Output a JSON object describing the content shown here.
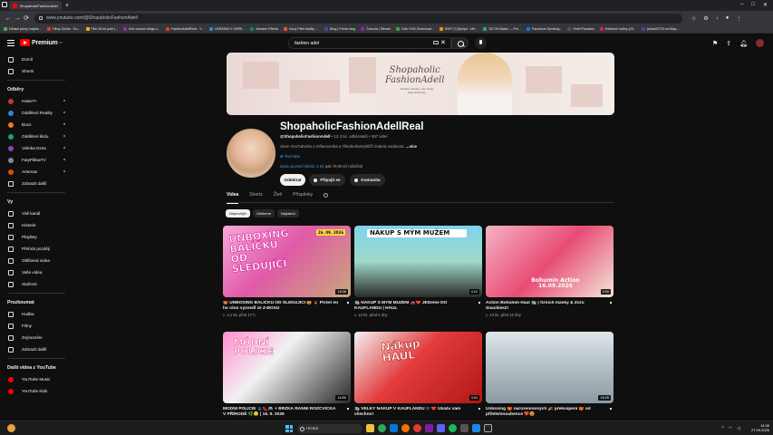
{
  "browser": {
    "tab_title": "ShopaholicFashionAdell...",
    "url": "www.youtube.com/@ShopaholicFashionAdell",
    "bookmarks": [
      "Dětské pleny hrajete...",
      "Filmy Online - Du...",
      "Film 28 let poté (...",
      "free custom bingo c...",
      "FashionAdellReal - Y...",
      "UKRAINA V ONRE...",
      "Monsen Effects",
      "Nový Pillet Addity -...",
      "Blog | Fomin-blog",
      "Čarnola | Stream",
      "Kick VOD Download...",
      "S907 (7)(5)mp4 - Mé...",
      "SD Gif Maker — Fre...",
      "Facebook Symboly...",
      "Hotel Paradise",
      "Edněmní rodiny (20...",
      "janka00733 na Mojo..."
    ]
  },
  "header": {
    "logo_text": "Premium",
    "logo_badge": "CZ",
    "search_value": "fashion adel"
  },
  "sidebar": {
    "main": [
      {
        "label": "Domů",
        "icon": "home-icon"
      },
      {
        "label": "Shorts",
        "icon": "shorts-icon"
      }
    ],
    "subs_heading": "Odběry",
    "subs": [
      {
        "label": "HaiseT+",
        "color": "#c0392b"
      },
      {
        "label": "Oddělení Reality",
        "color": "#2e86de"
      },
      {
        "label": "Buco",
        "color": "#e67e22"
      },
      {
        "label": "Oddělení klidu",
        "color": "#16a085"
      },
      {
        "label": "Volinka Extra",
        "color": "#8e44ad"
      },
      {
        "label": "FatyPillowTV",
        "color": "#7f8c8d"
      },
      {
        "label": "Artemas",
        "color": "#d35400"
      },
      {
        "label": "Zobrazit další",
        "color": ""
      }
    ],
    "you_heading": "Vy",
    "you": [
      {
        "label": "Váš kanál",
        "icon": "channel-icon"
      },
      {
        "label": "Historie",
        "icon": "history-icon"
      },
      {
        "label": "Playlisty",
        "icon": "playlist-icon"
      },
      {
        "label": "Přehrát později",
        "icon": "watch-later-icon"
      },
      {
        "label": "Oblíbená videa",
        "icon": "like-icon"
      },
      {
        "label": "Vaše videa",
        "icon": "your-videos-icon"
      },
      {
        "label": "Stažené",
        "icon": "download-icon"
      }
    ],
    "explore_heading": "Prozkoumat",
    "explore": [
      {
        "label": "Hudba",
        "icon": "music-icon"
      },
      {
        "label": "Filmy",
        "icon": "movie-icon"
      },
      {
        "label": "Zvýrazněni",
        "icon": "highlights-icon"
      },
      {
        "label": "Zobrazit další",
        "icon": "chevron-down-icon"
      }
    ],
    "more_heading": "Další videa z YouTube",
    "more": [
      {
        "label": "YouTube Music",
        "icon": "youtube-music-icon"
      },
      {
        "label": "YouTube Kids",
        "icon": "youtube-kids-icon"
      }
    ]
  },
  "channel": {
    "name": "ShopaholicFashionAdellReal",
    "handle": "@ShopaholicFashionAdell",
    "meta": " • 12,3 tis. odběratelů • 397 videí",
    "description": "Jsem YouTuberka a Influencerka a Tiktokerka!Vyhlíží známá osobnost. ",
    "description_more": "...více",
    "link": "YouTube",
    "join_note": "Zona za první měsíc: 0 Kč",
    "join_note_gray": " pak 79,90 Kč měsíčně",
    "subscribe_label": "Odebírat",
    "join_label": "Připojit se",
    "shop_label": "Komunita",
    "banner_brand_top": "Shopaholic",
    "banner_brand_bottom": "FashionAdell",
    "banner_sub": "Fashion, Beauty, Life\nVlogs Haul Unboxing"
  },
  "tabs": [
    "Videa",
    "Shorts",
    "Živě",
    "Příspěvky"
  ],
  "chips": [
    "Nejnovější",
    "Oblíbené",
    "Nejstarší"
  ],
  "videos": [
    {
      "title": "🎁 UNBOXING BALÍČKU OD SLEDUJÍCÍ 😍 💄 Přišel mi ho ráno vyzvedl ze Z-BOXU",
      "meta": "▷ 4,1 tis.  před 17 h",
      "duration": "18:36",
      "thumb_text": "UNBOXING BALÍČKU OD SLEDUJÍCÍ",
      "date_badge": "26. 09. 2026",
      "color": "#d95ca8"
    },
    {
      "title": "🛍️ NÁKUP S MÝM MUŽEM 🚗❤️ JEDeme DO KAUFLANDU | HAUL",
      "meta": "▷ 12 tis.  před 5 dny",
      "duration": "4:12",
      "thumb_text": "NÁKUP S MÝM MUŽEM",
      "date_badge": "",
      "color": "#5ec1e6"
    },
    {
      "title": "Action Bohumín Haul 🛍️ | Grinch masky & Zuru Snackies2!",
      "meta": "▷ 12 tis.  před 10 dny",
      "duration": "9:50",
      "thumb_text": "Bohumín Action 16.09.2026",
      "date_badge": "",
      "color": "#e96a8c"
    },
    {
      "title": "MÓDNÍ POLICIE 👗👠🚔 + BRZKÁ RANNÍ ROZCVIČKA V PŘÍRODĚ 🌿😊 | 16. 9. 2026",
      "meta": "",
      "duration": "16:50",
      "thumb_text": "MÓDNÍ POLICIE",
      "date_badge": "",
      "color": "#e84393"
    },
    {
      "title": "🛍️ VELKÝ NÁKUP V KAUFLANDU 🛒❤️ Ukážu vám všechno!",
      "meta": "",
      "duration": "3:04",
      "thumb_text": "Nákup HAUL",
      "date_badge": "",
      "color": "#d63031"
    },
    {
      "title": "Unboxing 🎁 narozeninových 🎉 překvapení 🎁 od přítele/snoubence ❤️😍",
      "meta": "",
      "duration": "16:26",
      "thumb_text": "",
      "date_badge": "",
      "color": "#b8c6cc"
    }
  ],
  "taskbar": {
    "search_placeholder": "Hledat",
    "time": "14:30",
    "date": "27.09.2026"
  }
}
